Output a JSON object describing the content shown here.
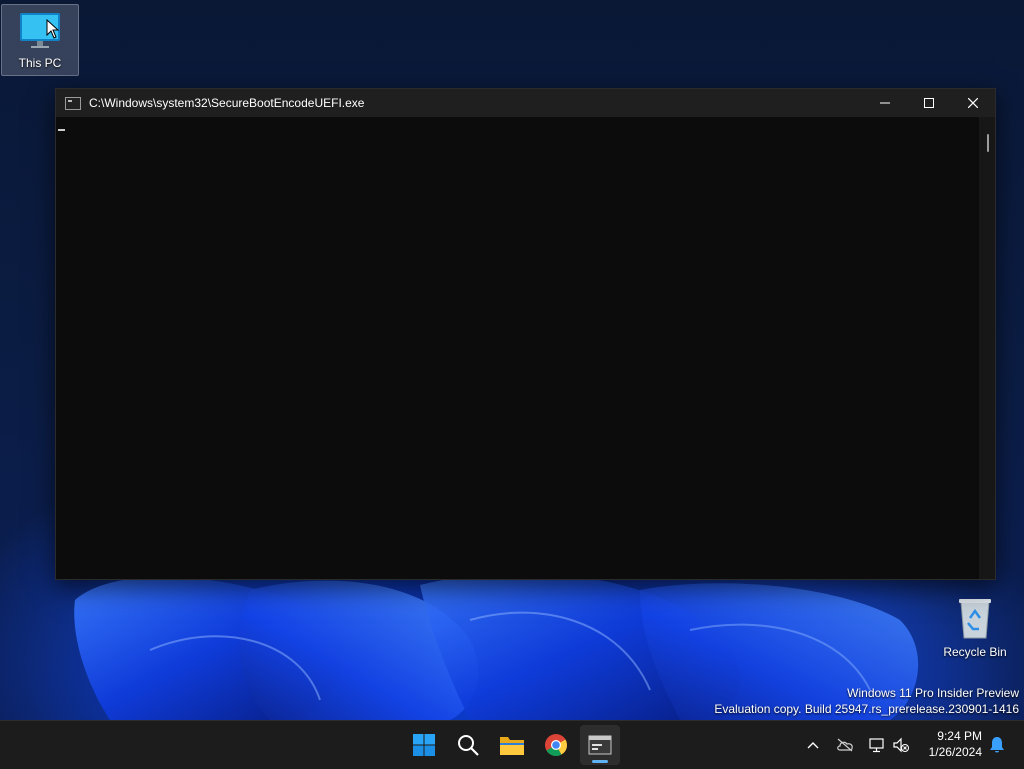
{
  "desktop": {
    "icons": [
      {
        "label": "This PC",
        "icon": "monitor-icon"
      },
      {
        "label": "Recycle Bin",
        "icon": "recycle-bin-icon"
      }
    ],
    "watermark": {
      "line1": "Windows 11 Pro Insider Preview",
      "line2": "Evaluation copy. Build 25947.rs_prerelease.230901-1416"
    }
  },
  "console_window": {
    "title": "C:\\Windows\\system32\\SecureBootEncodeUEFI.exe",
    "buttons": {
      "minimize": "minimize-icon",
      "maximize": "maximize-icon",
      "close": "close-icon"
    },
    "background": "#0c0c0c"
  },
  "taskbar": {
    "apps": [
      "start-icon",
      "search-icon",
      "file-explorer-icon",
      "chrome-icon",
      "terminal-icon"
    ],
    "active_app": "terminal-icon",
    "tray": [
      "chevron-up-icon",
      "onedrive-offline-icon",
      "network-icon",
      "volume-muted-icon"
    ],
    "clock": {
      "time": "9:24 PM",
      "date": "1/26/2024"
    },
    "notification": "bell-icon"
  }
}
